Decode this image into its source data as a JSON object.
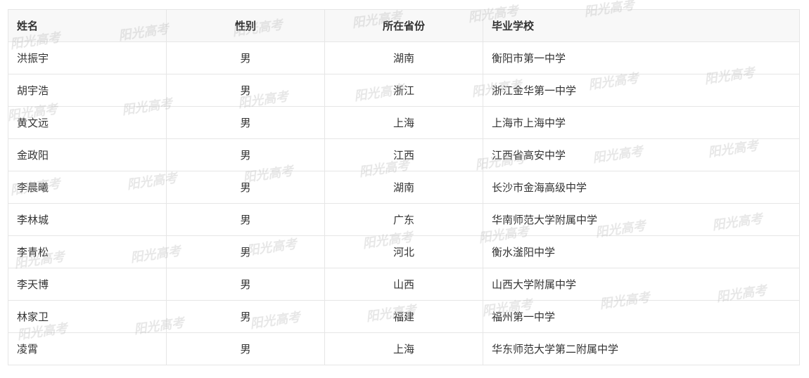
{
  "table": {
    "headers": [
      "姓名",
      "性别",
      "所在省份",
      "毕业学校"
    ],
    "rows": [
      [
        "洪振宇",
        "男",
        "湖南",
        "衡阳市第一中学"
      ],
      [
        "胡宇浩",
        "男",
        "浙江",
        "浙江金华第一中学"
      ],
      [
        "黄文远",
        "男",
        "上海",
        "上海市上海中学"
      ],
      [
        "金政阳",
        "男",
        "江西",
        "江西省高安中学"
      ],
      [
        "李晨曦",
        "男",
        "湖南",
        "长沙市金海高级中学"
      ],
      [
        "李林城",
        "男",
        "广东",
        "华南师范大学附属中学"
      ],
      [
        "李青松",
        "男",
        "河北",
        "衡水滏阳中学"
      ],
      [
        "李天博",
        "男",
        "山西",
        "山西大学附属中学"
      ],
      [
        "林家卫",
        "男",
        "福建",
        "福州第一中学"
      ],
      [
        "凌霄",
        "男",
        "上海",
        "华东师范大学第二附属中学"
      ]
    ]
  },
  "watermark": {
    "text": "阳光高考"
  },
  "colors": {
    "border": "#e6e6e6",
    "header_bg": "#f8f8f8",
    "text": "#333333"
  }
}
